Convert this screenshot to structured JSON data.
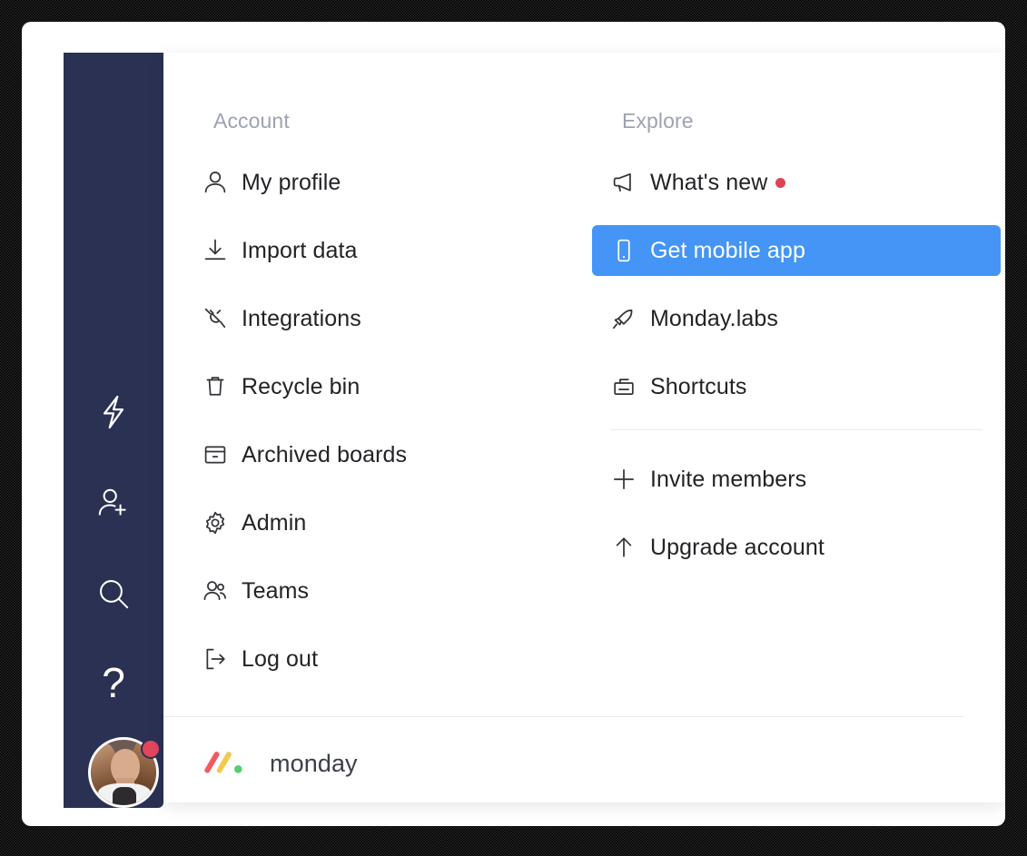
{
  "theme": {
    "rail_bg": "#2b3153",
    "accent_blue": "#4495f5",
    "badge_red": "#e04256",
    "title_gray": "#9ea2b3",
    "text_dark": "#222326"
  },
  "rail": {
    "items": [
      {
        "id": "quick-actions",
        "icon": "lightning-bolt-icon"
      },
      {
        "id": "invite-member",
        "icon": "add-person-icon"
      },
      {
        "id": "search",
        "icon": "search-icon"
      },
      {
        "id": "help",
        "icon": "question-mark-icon",
        "glyph": "?"
      }
    ],
    "avatar": {
      "name": "avatar",
      "has_notification": true
    }
  },
  "panel": {
    "columns": [
      {
        "title": "Account",
        "items": [
          {
            "label": "My profile",
            "icon": "person-icon"
          },
          {
            "label": "Import data",
            "icon": "download-icon"
          },
          {
            "label": "Integrations",
            "icon": "plug-icon"
          },
          {
            "label": "Recycle bin",
            "icon": "trash-icon"
          },
          {
            "label": "Archived boards",
            "icon": "archive-box-icon"
          },
          {
            "label": "Admin",
            "icon": "gear-icon"
          },
          {
            "label": "Teams",
            "icon": "people-icon"
          },
          {
            "label": "Log out",
            "icon": "logout-icon"
          }
        ]
      },
      {
        "title": "Explore",
        "items": [
          {
            "label": "What's new",
            "icon": "megaphone-icon",
            "badge": true,
            "selected": false
          },
          {
            "label": "Get mobile app",
            "icon": "mobile-phone-icon",
            "badge": false,
            "selected": true
          },
          {
            "label": "Monday.labs",
            "icon": "rocket-icon",
            "badge": false,
            "selected": false
          },
          {
            "label": "Shortcuts",
            "icon": "shortcuts-box-icon",
            "badge": false,
            "selected": false
          }
        ],
        "items_after_divider": [
          {
            "label": "Invite members",
            "icon": "plus-icon"
          },
          {
            "label": "Upgrade account",
            "icon": "arrow-up-icon"
          }
        ]
      }
    ],
    "brand": {
      "name": "monday",
      "logo": "monday-logo-icon",
      "logo_colors": {
        "red": "#f15a60",
        "yellow": "#f2c94c",
        "green": "#53d06a"
      }
    }
  }
}
